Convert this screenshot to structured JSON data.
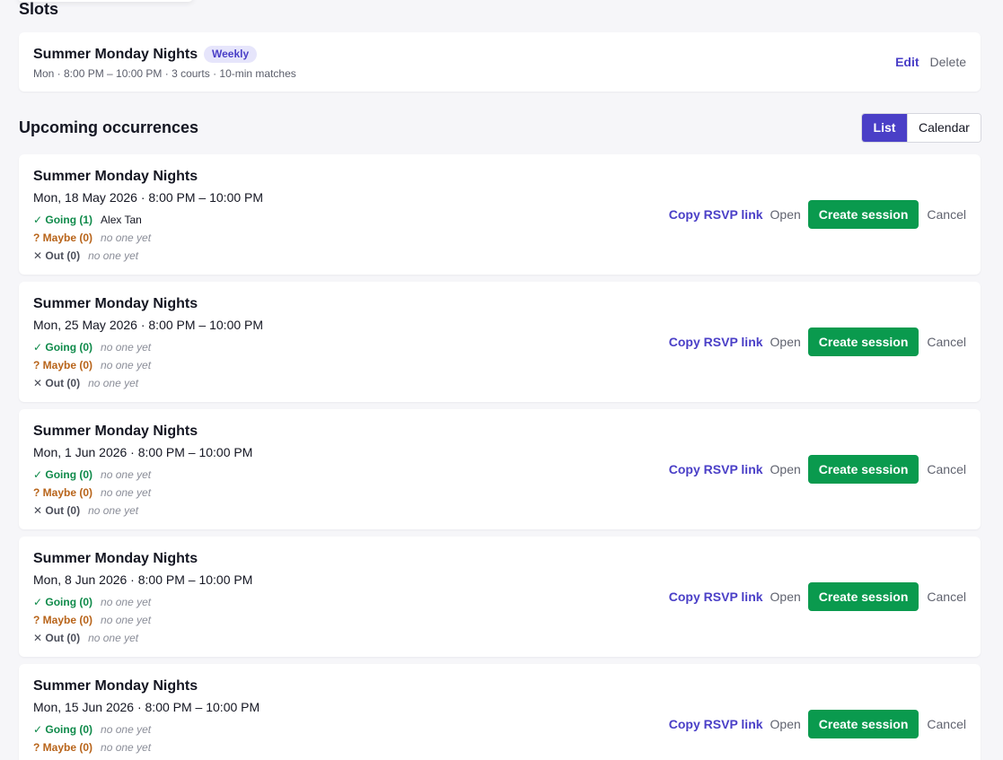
{
  "slots": {
    "title": "Slots",
    "items": [
      {
        "name": "Summer Monday Nights",
        "badge": "Weekly",
        "meta": "Mon · 8:00 PM – 10:00 PM · 3 courts · 10-min matches",
        "edit_label": "Edit",
        "delete_label": "Delete"
      }
    ]
  },
  "upcoming": {
    "title": "Upcoming occurrences",
    "view_toggle": {
      "list": "List",
      "calendar": "Calendar",
      "active": "List"
    },
    "actions": {
      "copy_rsvp": "Copy RSVP link",
      "open": "Open",
      "create_session": "Create session",
      "cancel": "Cancel"
    },
    "occurrences": [
      {
        "title": "Summer Monday Nights",
        "date": "Mon, 18 May 2026 · 8:00 PM – 10:00 PM",
        "going": "✓ Going (1)",
        "going_who": "Alex Tan",
        "maybe": "? Maybe (0)",
        "maybe_who": "no one yet",
        "out": "Out (0)",
        "out_who": "no one yet"
      },
      {
        "title": "Summer Monday Nights",
        "date": "Mon, 25 May 2026 · 8:00 PM – 10:00 PM",
        "going": "✓ Going (0)",
        "going_who": "no one yet",
        "maybe": "? Maybe (0)",
        "maybe_who": "no one yet",
        "out": "Out (0)",
        "out_who": "no one yet"
      },
      {
        "title": "Summer Monday Nights",
        "date": "Mon, 1 Jun 2026 · 8:00 PM – 10:00 PM",
        "going": "✓ Going (0)",
        "going_who": "no one yet",
        "maybe": "? Maybe (0)",
        "maybe_who": "no one yet",
        "out": "Out (0)",
        "out_who": "no one yet"
      },
      {
        "title": "Summer Monday Nights",
        "date": "Mon, 8 Jun 2026 · 8:00 PM – 10:00 PM",
        "going": "✓ Going (0)",
        "going_who": "no one yet",
        "maybe": "? Maybe (0)",
        "maybe_who": "no one yet",
        "out": "Out (0)",
        "out_who": "no one yet"
      },
      {
        "title": "Summer Monday Nights",
        "date": "Mon, 15 Jun 2026 · 8:00 PM – 10:00 PM",
        "going": "✓ Going (0)",
        "going_who": "no one yet",
        "maybe": "? Maybe (0)",
        "maybe_who": "no one yet"
      }
    ]
  },
  "colors": {
    "accent": "#4a3fc7",
    "success": "#0a9a4e",
    "going": "#0f8a4a",
    "maybe": "#b8641a"
  }
}
